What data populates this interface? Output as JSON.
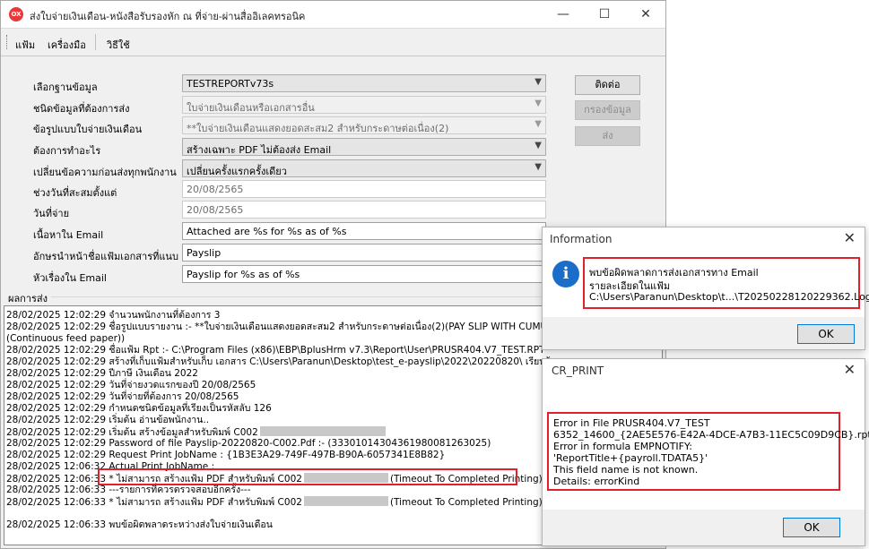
{
  "main_window": {
    "title": "ส่งใบจ่ายเงินเดือน-หนังสือรับรองหัก ณ ที่จ่าย-ผ่านสื่ออิเลคทรอนิค",
    "app_icon_text": "OX",
    "controls": {
      "minimize": "—",
      "maximize": "☐",
      "close": "✕"
    }
  },
  "menu": {
    "file": "แฟ้ม",
    "tools": "เครื่องมือ",
    "howto": "วิธีใช้"
  },
  "form": {
    "database": {
      "label": "เลือกฐานข้อมูล",
      "value": "TESTREPORTv73s"
    },
    "data_type": {
      "label": "ชนิดข้อมูลที่ต้องการส่ง",
      "value": "ใบจ่ายเงินเดือนหรือเอกสารอื่น"
    },
    "payslip_format": {
      "label": "ข้อรูปแบบใบจ่ายเงินเดือน",
      "value": "**ใบจ่ายเงินเดือนแสดงยอดสะสม2 สำหรับกระดาษต่อเนื่อง(2)"
    },
    "action": {
      "label": "ต้องการทำอะไร",
      "value": "สร้างเฉพาะ PDF ไม่ต้องส่ง Email"
    },
    "change_message": {
      "label": "เปลี่ยนข้อความก่อนส่งทุกพนักงาน",
      "value": "เปลี่ยนครั้งแรกครั้งเดียว"
    },
    "accum_date": {
      "label": "ช่วงวันที่สะสมตั้งแต่",
      "value": "20/08/2565"
    },
    "pay_date": {
      "label": "วันที่จ่าย",
      "value": "20/08/2565"
    },
    "email_body": {
      "label": "เนื้อหาใน Email",
      "value": "Attached are %s for %s as of %s"
    },
    "file_prefix": {
      "label": "อักษรนำหน้าชื่อแฟ้มเอกสารที่แนบ",
      "value": "Payslip"
    },
    "email_subject": {
      "label": "หัวเรื่องใน Email",
      "value": "Payslip for %s as of %s"
    }
  },
  "buttons": {
    "connect": "ติดต่อ",
    "filter": "กรองข้อมูล",
    "send": "ส่ง"
  },
  "results": {
    "label": "ผลการส่ง",
    "lines": [
      "28/02/2025 12:02:29 จำนวนพนักงานที่ต้องการ 3",
      "28/02/2025 12:02:29 ชื่อรูปแบบรายงาน :- **ใบจ่ายเงินเดือนแสดงยอดสะสม2 สำหรับกระดาษต่อเนื่อง(2)(PAY SLIP WITH CUMUL",
      "(Continuous feed paper))",
      "28/02/2025 12:02:29 ชื่อแฟ้ม Rpt :- C:\\Program Files (x86)\\EBP\\BplusHrm v7.3\\Report\\User\\PRUSR404.V7_TEST.RPT",
      "28/02/2025 12:02:29 สร้างที่เก็บแฟ้มสำหรับเก็บ เอกสาร C:\\Users\\Paranun\\Desktop\\test_e-payslip\\2022\\20220820\\ เรียบร้อย",
      "28/02/2025 12:02:29 ปีภาษี เงินเดือน 2022",
      "28/02/2025 12:02:29 วันที่จ่ายงวดแรกของปี 20/08/2565",
      "28/02/2025 12:02:29 วันที่จ่ายที่ต้องการ 20/08/2565",
      "28/02/2025 12:02:29 กำหนดชนิดข้อมูลที่เรียงเป็นรหัสลับ 126",
      "28/02/2025 12:02:29 เริ่มต้น อ่านข้อพนักงาน..",
      "28/02/2025 12:02:29 เริ่มต้น สร้างข้อมูลสำหรับพิมพ์ C002",
      "28/02/2025 12:02:29 Password of file Payslip-20220820-C002.Pdf :- (33301014304361980081263025)",
      "28/02/2025 12:02:29 Request Print JobName : {1B3E3A29-749F-497B-B90A-6057341E8B82}",
      "28/02/2025 12:06:32 Actual Print JobName :",
      "28/02/2025 12:06:33 * ไม่สามารถ สร้างแฟ้ม PDF สำหรับพิมพ์ C002",
      "28/02/2025 12:06:33 ---รายการที่ควรตรวจสอบอีกครั้ง---",
      "28/02/2025 12:06:33 * ไม่สามารถ สร้างแฟ้ม PDF สำหรับพิมพ์ C002",
      "",
      "28/02/2025 12:06:33 พบข้อผิดพลาดระหว่างส่งใบจ่ายเงินเดือน"
    ],
    "timeout_suffix": "(Timeout To Completed Printing)"
  },
  "info_dialog": {
    "title": "Information",
    "icon_glyph": "i",
    "close": "✕",
    "lines": [
      "พบข้อผิดพลาดการส่งเอกสารทาง Email",
      "รายละเอียดในแฟ้ม",
      "C:\\Users\\Paranun\\Desktop\\t...\\T20250228120229362.Log"
    ],
    "ok": "OK"
  },
  "cr_dialog": {
    "title": "CR_PRINT",
    "close": "✕",
    "lines": [
      "Error in File PRUSR404.V7_TEST",
      "6352_14600_{2AE5E576-E42A-4DCE-A7B3-11EC5C09D9CB}.rpt:",
      "Error in formula  EMPNOTIFY:",
      "'ReportTitle+{payroll.TDATA5}'",
      "This field name is not known.",
      "Details: errorKind"
    ],
    "ok": "OK"
  },
  "colors": {
    "highlight_red": "#e0202a",
    "info_blue": "#1a6ec9",
    "ok_border": "#0078d7"
  }
}
